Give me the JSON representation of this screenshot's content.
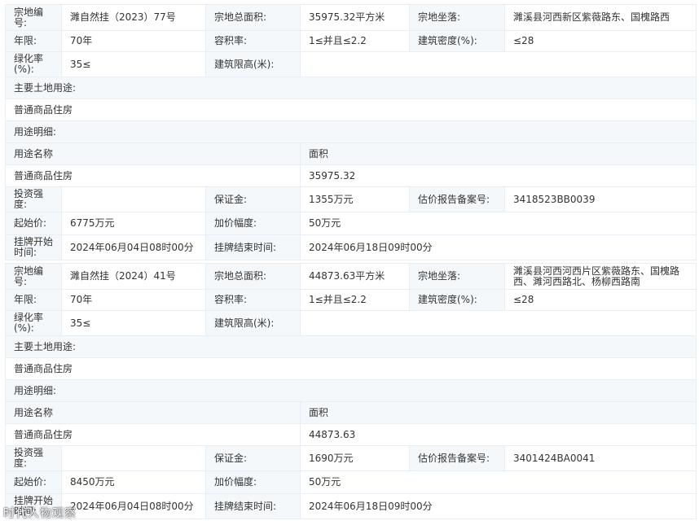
{
  "labels": {
    "parcel_no": "宗地编号:",
    "total_area": "宗地总面积:",
    "location": "宗地坐落:",
    "term": "年限:",
    "plot_ratio": "容积率:",
    "building_density": "建筑密度(%):",
    "greening_rate": "绿化率(%):",
    "height_limit": "建筑限高(米):",
    "main_use": "主要土地用途:",
    "use_detail": "用途明细:",
    "use_name": "用途名称",
    "area": "面积",
    "investment_intensity": "投资强度:",
    "deposit": "保证金:",
    "appraisal_no": "估价报告备案号:",
    "start_price": "起始价:",
    "increment": "加价幅度:",
    "listing_start": "挂牌开始时间:",
    "listing_end": "挂牌结束时间:"
  },
  "parcels": [
    {
      "parcel_no": "濉自然挂（2023）77号",
      "total_area": "35975.32平方米",
      "location": "濉溪县河西新区紫薇路东、国槐路西",
      "term": "70年",
      "plot_ratio": "1≤并且≤2.2",
      "building_density": "≤28",
      "greening_rate": "35≤",
      "height_limit": "",
      "main_use": "普通商品住房",
      "use_name": "普通商品住房",
      "use_area": "35975.32",
      "investment_intensity": "",
      "deposit": "1355万元",
      "appraisal_no": "3418523BB0039",
      "start_price": "6775万元",
      "increment": "50万元",
      "listing_start": "2024年06月04日08时00分",
      "listing_end": "2024年06月18日09时00分"
    },
    {
      "parcel_no": "濉自然挂（2024）41号",
      "total_area": "44873.63平方米",
      "location": "濉溪县河西河西片区紫薇路东、国槐路西、濉河西路北、杨柳西路南",
      "term": "70年",
      "plot_ratio": "1≤并且≤2.2",
      "building_density": "≤28",
      "greening_rate": "35≤",
      "height_limit": "",
      "main_use": "普通商品住房",
      "use_name": "普通商品住房",
      "use_area": "44873.63",
      "investment_intensity": "",
      "deposit": "1690万元",
      "appraisal_no": "3401424BA0041",
      "start_price": "8450万元",
      "increment": "50万元",
      "listing_start": "2024年06月04日08时00分",
      "listing_end": "2024年06月18日09时00分"
    }
  ],
  "watermark": "时代人物观察"
}
